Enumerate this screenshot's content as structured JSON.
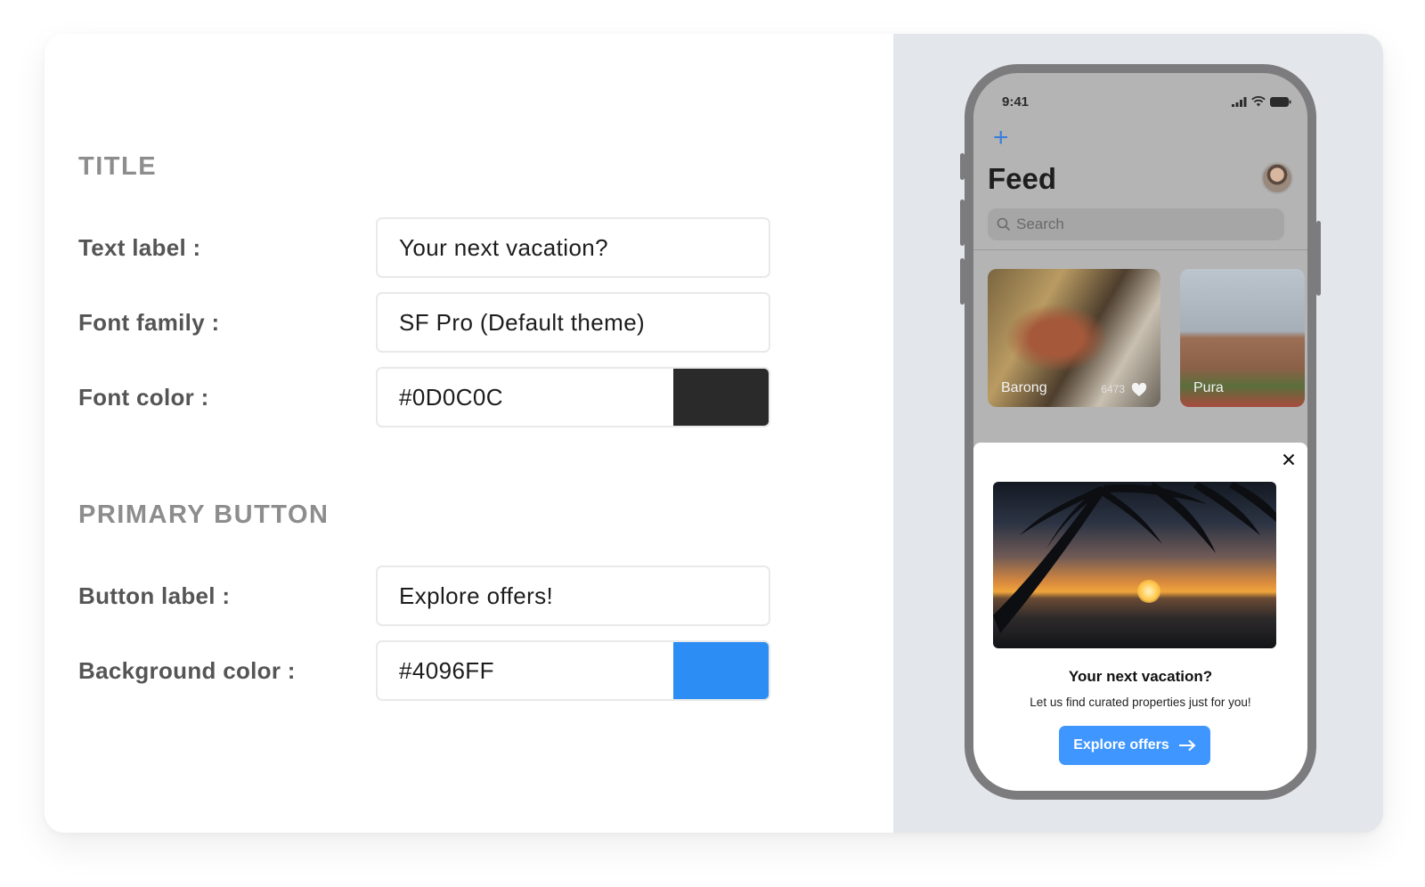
{
  "settings": {
    "title_section": {
      "heading": "TITLE",
      "fields": {
        "text_label": {
          "label": "Text label :",
          "value": "Your next vacation?"
        },
        "font_family": {
          "label": "Font family :",
          "value": "SF Pro (Default theme)"
        },
        "font_color": {
          "label": "Font color :",
          "value": "#0D0C0C",
          "swatch": "#2a2a2a"
        }
      }
    },
    "button_section": {
      "heading": "PRIMARY BUTTON",
      "fields": {
        "button_label": {
          "label": "Button label :",
          "value": "Explore offers!"
        },
        "background_color": {
          "label": "Background color :",
          "value": "#4096FF",
          "swatch": "#2c8ef5"
        }
      }
    }
  },
  "preview": {
    "status_time": "9:41",
    "feed_title": "Feed",
    "search_placeholder": "Search",
    "tiles": [
      {
        "label": "Barong",
        "count": "6473"
      },
      {
        "label": "Pura"
      }
    ],
    "modal": {
      "title": "Your next vacation?",
      "subtitle": "Let us find curated properties just for you!",
      "button_label": "Explore offers",
      "button_color": "#4096ff"
    }
  },
  "icons": [
    "plus-icon",
    "avatar",
    "search-icon",
    "heart-icon",
    "close-icon",
    "arrow-right-icon",
    "signal-icon",
    "wifi-icon",
    "battery-icon"
  ]
}
